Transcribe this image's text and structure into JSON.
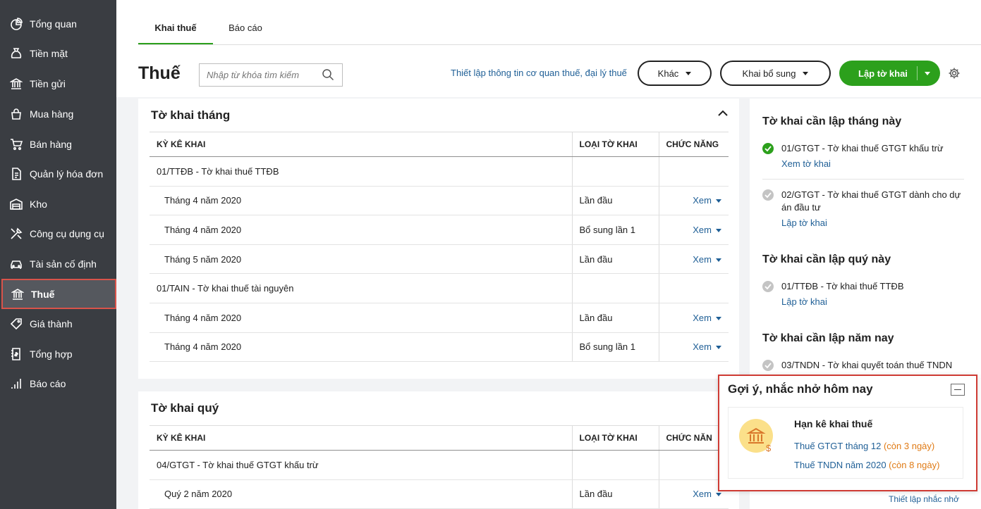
{
  "colors": {
    "sidebar_bg": "#3a3d42",
    "accent_green": "#2ca01c",
    "link_blue": "#1f5f96",
    "highlight_red": "#cf3b34",
    "due_orange": "#e07b16"
  },
  "sidebar": {
    "items": [
      {
        "label": "Tổng quan",
        "icon": "dashboard-icon"
      },
      {
        "label": "Tiền mặt",
        "icon": "money-bag-icon"
      },
      {
        "label": "Tiền gửi",
        "icon": "bank-icon"
      },
      {
        "label": "Mua hàng",
        "icon": "shopping-bag-icon"
      },
      {
        "label": "Bán hàng",
        "icon": "cart-icon"
      },
      {
        "label": "Quản lý hóa đơn",
        "icon": "invoice-icon"
      },
      {
        "label": "Kho",
        "icon": "warehouse-icon"
      },
      {
        "label": "Công cụ dụng cụ",
        "icon": "tools-icon"
      },
      {
        "label": "Tài sản cố định",
        "icon": "car-icon"
      },
      {
        "label": "Thuế",
        "icon": "tax-bank-icon",
        "active": true
      },
      {
        "label": "Giá thành",
        "icon": "price-tag-icon"
      },
      {
        "label": "Tổng hợp",
        "icon": "ledger-icon"
      },
      {
        "label": "Báo cáo",
        "icon": "bar-chart-icon"
      }
    ]
  },
  "tabs": [
    {
      "label": "Khai thuế",
      "active": true
    },
    {
      "label": "Báo cáo",
      "active": false
    }
  ],
  "header": {
    "title": "Thuế",
    "search_placeholder": "Nhập từ khóa tìm kiếm",
    "setup_link": "Thiết lập thông tin cơ quan thuế, đại lý thuế",
    "other_button": "Khác",
    "supplement_button": "Khai bổ sung",
    "create_button": "Lập tờ khai"
  },
  "monthly": {
    "title": "Tờ khai tháng",
    "columns": [
      "KỲ KÊ KHAI",
      "LOẠI TỜ KHAI",
      "CHỨC NĂNG"
    ],
    "groups": [
      {
        "name": "01/TTĐB - Tờ khai thuế TTĐB",
        "rows": [
          {
            "period": "Tháng 4 năm 2020",
            "type": "Lần đầu",
            "action": "Xem"
          },
          {
            "period": "Tháng 4 năm 2020",
            "type": "Bổ sung lần 1",
            "action": "Xem"
          },
          {
            "period": "Tháng 5 năm 2020",
            "type": "Lần đầu",
            "action": "Xem"
          }
        ]
      },
      {
        "name": "01/TAIN - Tờ khai thuế tài nguyên",
        "rows": [
          {
            "period": "Tháng 4 năm 2020",
            "type": "Lần đầu",
            "action": "Xem"
          },
          {
            "period": "Tháng 4 năm 2020",
            "type": "Bổ sung lần 1",
            "action": "Xem"
          }
        ]
      }
    ]
  },
  "quarterly": {
    "title": "Tờ khai quý",
    "columns": [
      "KỲ KÊ KHAI",
      "LOẠI TỜ KHAI",
      "CHỨC NĂN"
    ],
    "groups": [
      {
        "name": "04/GTGT - Tờ khai thuế GTGT khấu trừ",
        "rows": [
          {
            "period": "Quý 2 năm 2020",
            "type": "Lần đầu",
            "action": "Xem"
          }
        ]
      }
    ]
  },
  "right_panel": {
    "month_title": "Tờ khai cần lập tháng này",
    "month_items": [
      {
        "text": "01/GTGT - Tờ khai thuế GTGT khấu trừ",
        "link": "Xem tờ khai",
        "status": "done"
      },
      {
        "text": "02/GTGT - Tờ khai thuế GTGT dành cho dự án đầu tư",
        "link": "Lập tờ khai",
        "status": "todo"
      }
    ],
    "quarter_title": "Tờ khai cần lập quý này",
    "quarter_items": [
      {
        "text": "01/TTĐB - Tờ khai thuế TTĐB",
        "link": "Lập tờ khai",
        "status": "todo"
      }
    ],
    "year_title": "Tờ khai cần lập năm nay",
    "year_items": [
      {
        "text": "03/TNDN - Tờ khai quyết toán thuế TNDN",
        "status": "todo"
      }
    ]
  },
  "reminder": {
    "title": "Gợi ý, nhắc nhở hôm nay",
    "heading": "Hạn kê khai thuế",
    "items": [
      {
        "text": "Thuế GTGT tháng 12",
        "due": "(còn 3 ngày)"
      },
      {
        "text": "Thuế TNDN năm 2020",
        "due": "(còn 8 ngày)"
      }
    ],
    "setup_link": "Thiết lập nhắc nhở"
  }
}
